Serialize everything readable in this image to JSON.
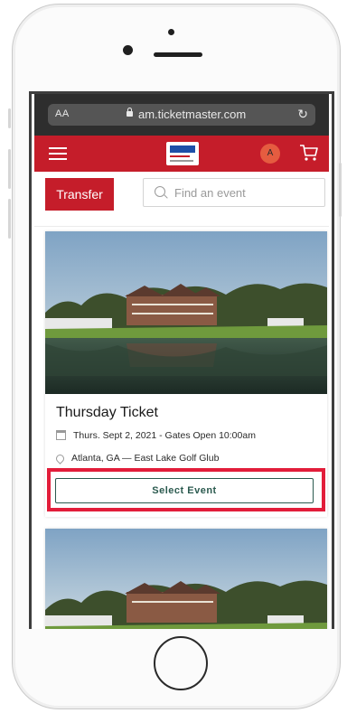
{
  "browser": {
    "text_size_label": "AA",
    "url": "am.ticketmaster.com",
    "reload_icon": "reload-icon"
  },
  "header": {
    "menu_icon": "hamburger-icon",
    "logo": "tour-championship-logo",
    "avatar_initial": "A",
    "cart_icon": "cart-icon",
    "brand_color": "#c51d2a"
  },
  "toolbar": {
    "transfer_label": "Transfer",
    "search_placeholder": "Find an event"
  },
  "events": [
    {
      "title": "Thursday Ticket",
      "date_line": "Thurs. Sept 2, 2021 - Gates Open 10:00am",
      "location_line": "Atlanta, GA — East Lake Golf Glub",
      "button_label": "Select Event",
      "highlight_color": "#e21d3a"
    }
  ]
}
